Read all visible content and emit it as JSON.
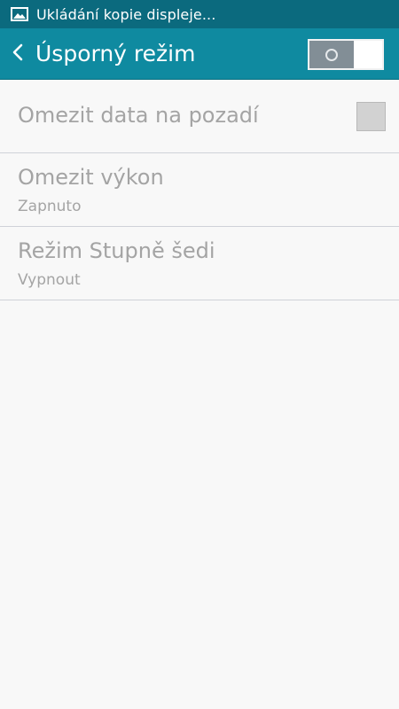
{
  "status_bar": {
    "icon": "image-icon",
    "notification": "Ukládání kopie displeje..."
  },
  "header": {
    "back_icon": "chevron-left-icon",
    "title": "Úsporný režim",
    "master_switch": {
      "state": "off"
    }
  },
  "settings": {
    "items": [
      {
        "title": "Omezit data na pozadí",
        "control": "checkbox",
        "checked": false
      },
      {
        "title": "Omezit výkon",
        "summary": "Zapnuto"
      },
      {
        "title": "Režim Stupně šedi",
        "summary": "Vypnout"
      }
    ]
  },
  "colors": {
    "status_bar": "#0b6a7e",
    "action_bar": "#0f8aa0",
    "background": "#f8f8f8",
    "text_disabled": "#a4a4a4",
    "divider": "#cfd2d8"
  }
}
